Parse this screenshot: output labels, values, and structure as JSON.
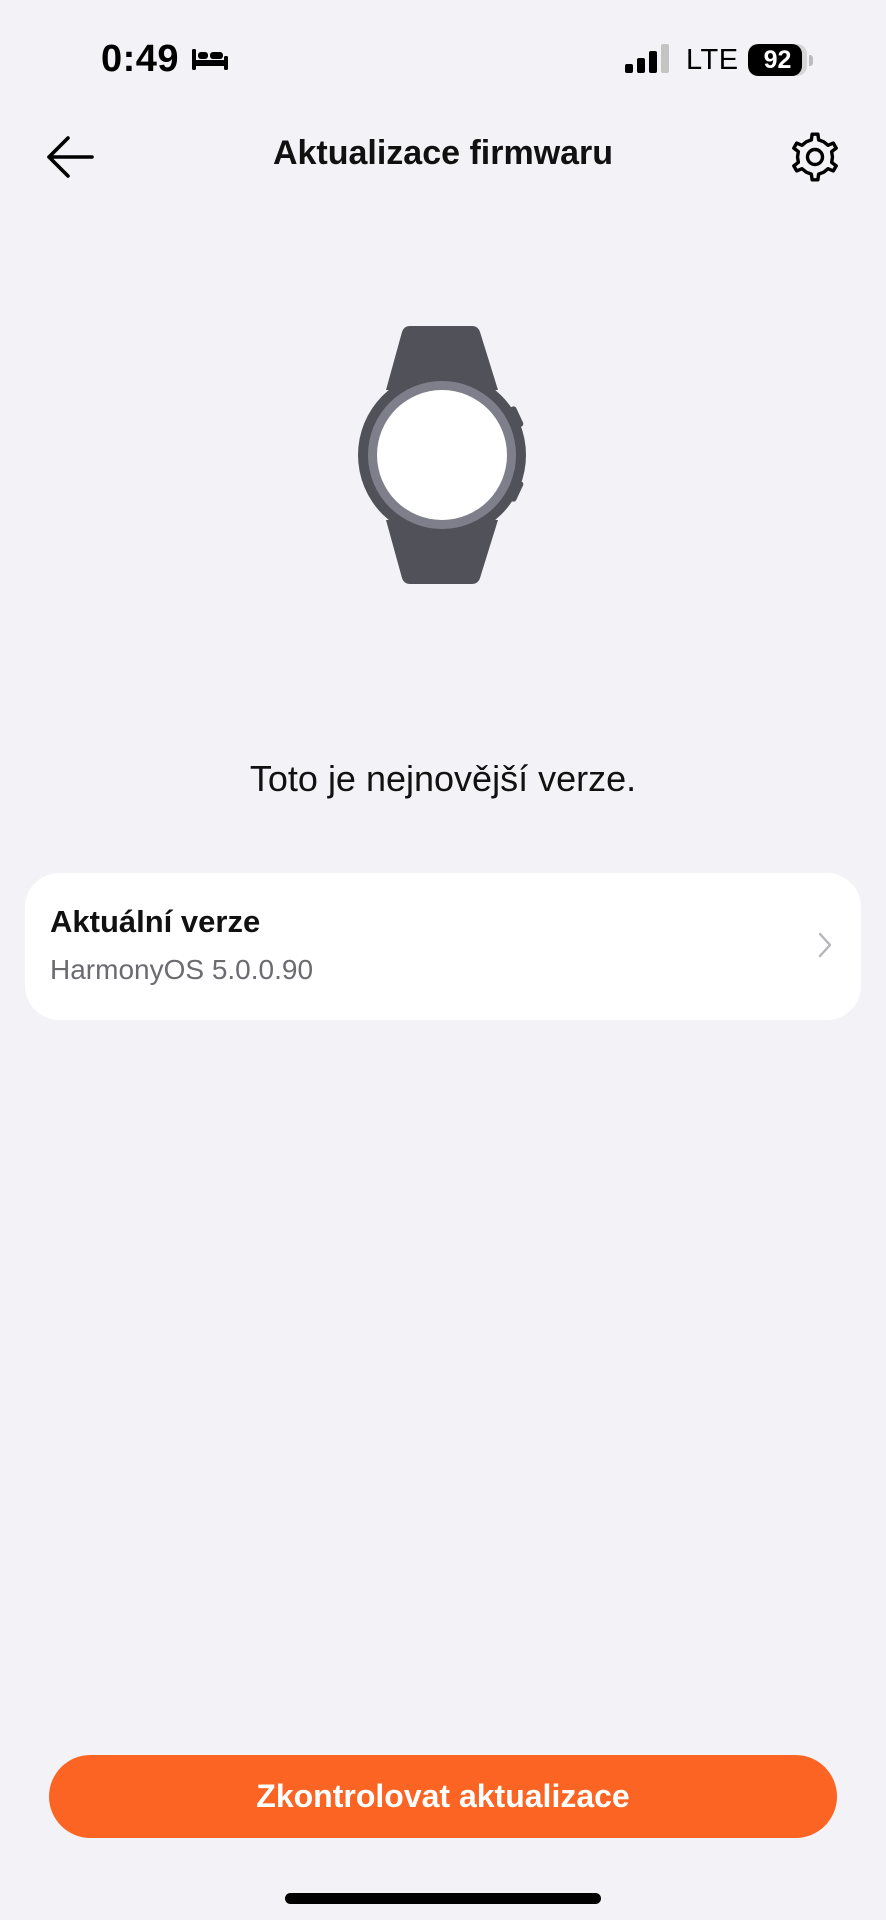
{
  "status_bar": {
    "time": "0:49",
    "network": "LTE",
    "battery_level": "92",
    "battery_fraction": 0.92,
    "icons": [
      "sleep-mode-icon",
      "cellular-signal-icon",
      "battery-icon"
    ]
  },
  "header": {
    "title": "Aktualizace firmwaru",
    "back_icon": "arrow-left-icon",
    "settings_icon": "gear-icon"
  },
  "illustration": {
    "icon": "smartwatch-icon",
    "colors": {
      "strap": "#515259",
      "bezel": "#7e7f8a",
      "face": "#ffffff"
    }
  },
  "message": "Toto je nejnovější verze.",
  "version_card": {
    "title": "Aktuální verze",
    "value": "HarmonyOS 5.0.0.90",
    "chevron_icon": "chevron-right-icon"
  },
  "primary_button": {
    "label": "Zkontrolovat aktualizace",
    "color": "#fb6422"
  },
  "colors": {
    "background": "#f2f2f7",
    "card": "#ffffff",
    "accent": "#fb6422"
  }
}
